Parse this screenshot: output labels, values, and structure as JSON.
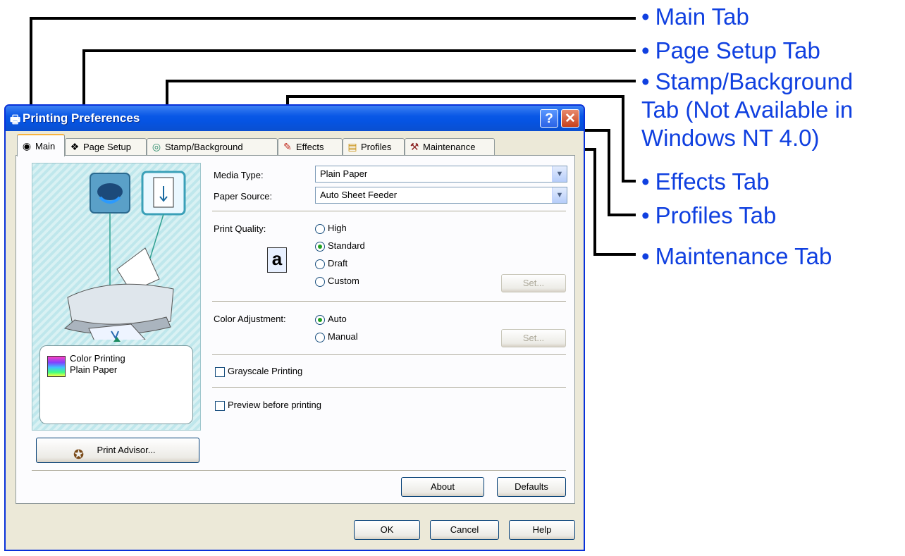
{
  "window": {
    "title": "Printing Preferences",
    "help_glyph": "?",
    "close_glyph": "✕"
  },
  "tabs": [
    {
      "label": "Main",
      "icon": "main-tab-icon",
      "active": true
    },
    {
      "label": "Page Setup",
      "icon": "page-setup-icon"
    },
    {
      "label": "Stamp/Background",
      "icon": "stamp-icon"
    },
    {
      "label": "Effects",
      "icon": "effects-icon"
    },
    {
      "label": "Profiles",
      "icon": "profiles-icon"
    },
    {
      "label": "Maintenance",
      "icon": "maintenance-icon"
    }
  ],
  "main": {
    "media_type_label": "Media Type:",
    "media_type_value": "Plain Paper",
    "paper_source_label": "Paper Source:",
    "paper_source_value": "Auto Sheet Feeder",
    "print_quality_label": "Print Quality:",
    "quality_options": [
      "High",
      "Standard",
      "Draft",
      "Custom"
    ],
    "quality_selected": "Standard",
    "quality_set_button": "Set...",
    "color_adjustment_label": "Color Adjustment:",
    "color_options": [
      "Auto",
      "Manual"
    ],
    "color_selected": "Auto",
    "color_set_button": "Set...",
    "grayscale_label": "Grayscale Printing",
    "preview_label": "Preview before printing",
    "info_line1": "Color Printing",
    "info_line2": "Plain Paper",
    "print_advisor_button": "Print Advisor...",
    "about_button": "About",
    "defaults_button": "Defaults"
  },
  "footer": {
    "ok_button": "OK",
    "cancel_button": "Cancel",
    "help_button": "Help"
  },
  "callouts": [
    "Main Tab",
    "Page Setup Tab",
    "Stamp/Background Tab (Not Available in Windows NT 4.0)",
    "Effects Tab",
    "Profiles Tab",
    "Maintenance Tab"
  ],
  "colors": {
    "callout_text": "#1040e0",
    "titlebar": "#0554e3",
    "active_tab_accent": "#f9b33e"
  }
}
